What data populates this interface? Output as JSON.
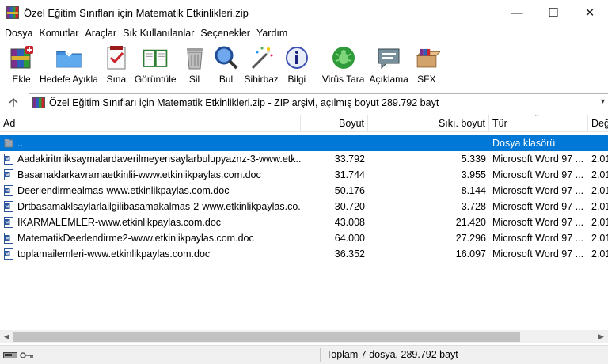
{
  "window": {
    "title": "Özel Eğitim Sınıfları için Matematik Etkinlikleri.zip",
    "minimize": "—",
    "maximize": "☐",
    "close": "✕"
  },
  "menu": [
    "Dosya",
    "Komutlar",
    "Araçlar",
    "Sık Kullanılanlar",
    "Seçenekler",
    "Yardım"
  ],
  "toolbar": {
    "items": [
      {
        "label": "Ekle",
        "icon": "add-archive-icon"
      },
      {
        "label": "Hedefe Ayıkla",
        "icon": "extract-folder-icon"
      },
      {
        "label": "Sına",
        "icon": "test-icon"
      },
      {
        "label": "Görüntüle",
        "icon": "view-book-icon"
      },
      {
        "label": "Sil",
        "icon": "trash-icon"
      },
      {
        "label": "Bul",
        "icon": "magnifier-icon"
      },
      {
        "label": "Sihirbaz",
        "icon": "wizard-wand-icon"
      },
      {
        "label": "Bilgi",
        "icon": "info-icon"
      },
      {
        "label": "Virüs Tara",
        "icon": "virus-scan-icon"
      },
      {
        "label": "Açıklama",
        "icon": "comment-icon"
      },
      {
        "label": "SFX",
        "icon": "sfx-box-icon"
      }
    ]
  },
  "address": {
    "text": "Özel Eğitim Sınıfları için Matematik Etkinlikleri.zip - ZIP arşivi, açılmış boyut 289.792 bayt",
    "up_icon": "up-arrow-icon"
  },
  "columns": {
    "name": "Ad",
    "size": "Boyut",
    "packed": "Sıkı. boyut",
    "type": "Tür",
    "modified": "Değ"
  },
  "rows": [
    {
      "name": "..",
      "size": "",
      "packed": "",
      "type": "Dosya klasörü",
      "modified": "",
      "selected": true,
      "icon": "parent-folder-icon"
    },
    {
      "name": "Aadakiritmiksaymalardaverilmeyensaylarbulupyaznz-3-www.etk...",
      "size": "33.792",
      "packed": "5.339",
      "type": "Microsoft Word 97 ...",
      "modified": "2.01",
      "icon": "word-doc-icon"
    },
    {
      "name": "Basamaklarkavramaetkinlii-www.etkinlikpaylas.com.doc",
      "size": "31.744",
      "packed": "3.955",
      "type": "Microsoft Word 97 ...",
      "modified": "2.01",
      "icon": "word-doc-icon"
    },
    {
      "name": "Deerlendirmealmas-www.etkinlikpaylas.com.doc",
      "size": "50.176",
      "packed": "8.144",
      "type": "Microsoft Word 97 ...",
      "modified": "2.01",
      "icon": "word-doc-icon"
    },
    {
      "name": "Drtbasamaklsaylarlailgilibasamakalmas-2-www.etkinlikpaylas.co...",
      "size": "30.720",
      "packed": "3.728",
      "type": "Microsoft Word 97 ...",
      "modified": "2.01",
      "icon": "word-doc-icon"
    },
    {
      "name": "IKARMALEMLER-www.etkinlikpaylas.com.doc",
      "size": "43.008",
      "packed": "21.420",
      "type": "Microsoft Word 97 ...",
      "modified": "2.01",
      "icon": "word-doc-icon"
    },
    {
      "name": "MatematikDeerlendirme2-www.etkinlikpaylas.com.doc",
      "size": "64.000",
      "packed": "27.296",
      "type": "Microsoft Word 97 ...",
      "modified": "2.01",
      "icon": "word-doc-icon"
    },
    {
      "name": "toplamailemleri-www.etkinlikpaylas.com.doc",
      "size": "36.352",
      "packed": "16.097",
      "type": "Microsoft Word 97 ...",
      "modified": "2.01",
      "icon": "word-doc-icon"
    }
  ],
  "status": {
    "text": "Toplam 7 dosya, 289.792 bayt",
    "drive_icon": "drive-icon",
    "key_icon": "key-icon"
  },
  "colors": {
    "selection": "#0078d7",
    "statusbar": "#f0f0f0"
  }
}
